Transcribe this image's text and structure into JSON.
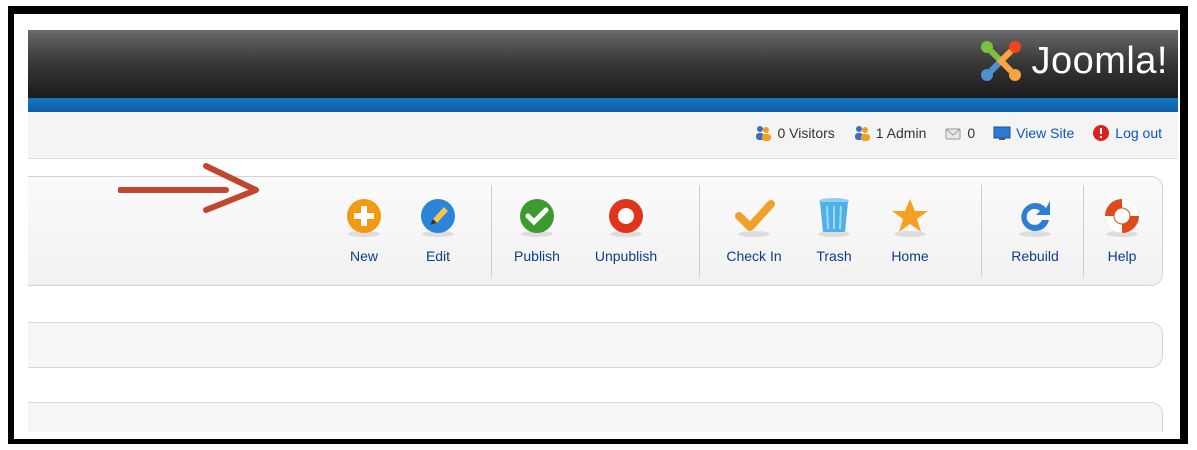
{
  "header": {
    "logo_text": "Joomla!"
  },
  "status": {
    "visitors": "0 Visitors",
    "admins": "1 Admin",
    "messages": "0",
    "view_site": "View Site",
    "logout": "Log out"
  },
  "toolbar": {
    "buttons": [
      {
        "label": "New",
        "icon": "plus-circle-icon",
        "color": "#f39a14"
      },
      {
        "label": "Edit",
        "icon": "pencil-icon",
        "color": "#2a85d8"
      },
      {
        "label": "Publish",
        "icon": "check-circle-icon",
        "color": "#3c9a2f"
      },
      {
        "label": "Unpublish",
        "icon": "stop-circle-icon",
        "color": "#e0341d"
      },
      {
        "label": "Check In",
        "icon": "checkmark-icon",
        "color": "#f1a12a"
      },
      {
        "label": "Trash",
        "icon": "trash-icon",
        "color": "#4fb0e8"
      },
      {
        "label": "Home",
        "icon": "star-icon",
        "color": "#f4a020"
      },
      {
        "label": "Rebuild",
        "icon": "refresh-icon",
        "color": "#2f7fd1"
      },
      {
        "label": "Help",
        "icon": "lifebuoy-icon",
        "color": "#e04a1a"
      }
    ]
  },
  "colors": {
    "header_dark": "#1a1a1a",
    "accent_blue": "#1877c5",
    "link": "#0b55c4",
    "annotation_arrow": "#c0462e"
  }
}
